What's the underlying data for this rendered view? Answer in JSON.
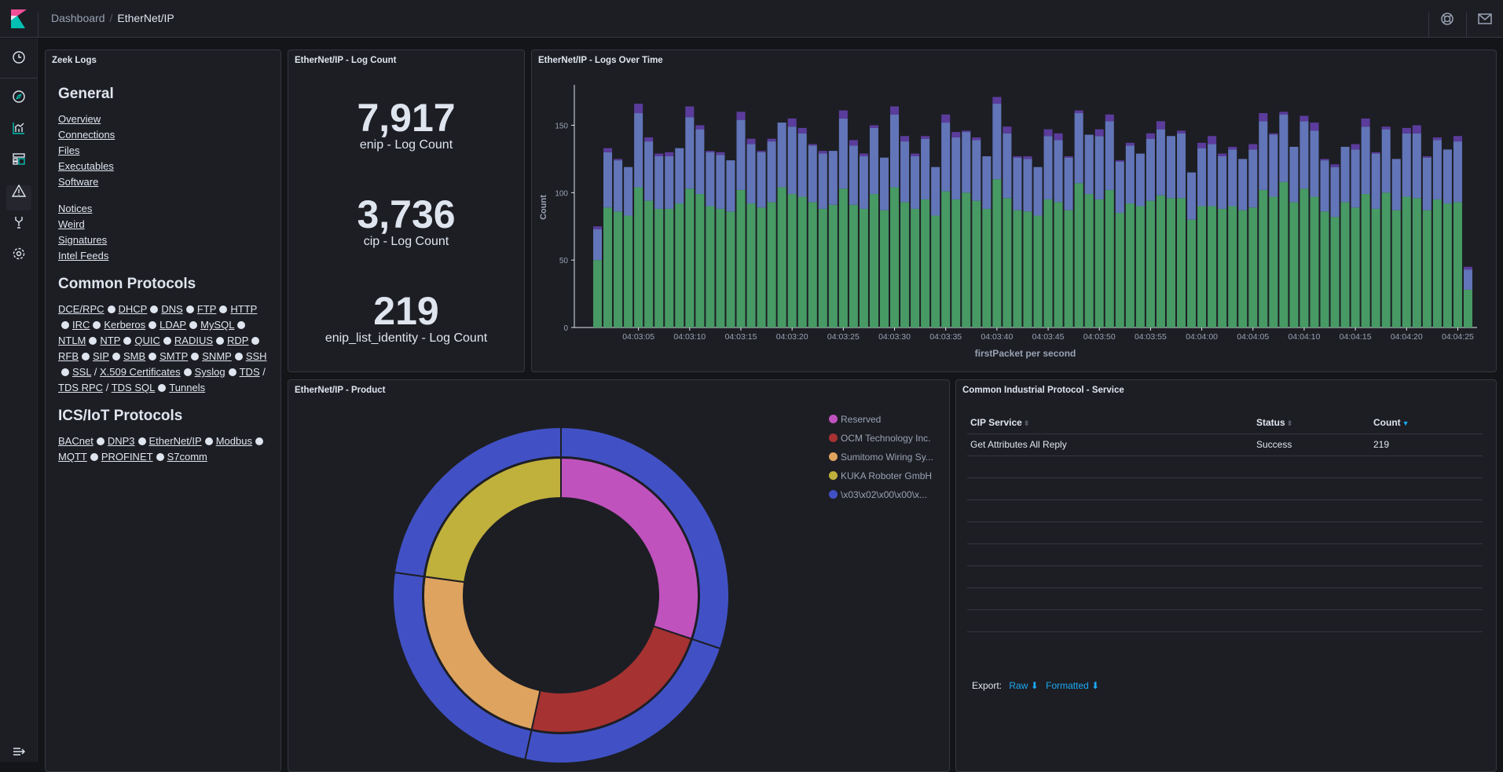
{
  "header": {
    "breadcrumb": [
      "Dashboard",
      "EtherNet/IP"
    ]
  },
  "zeek": {
    "title": "Zeek Logs",
    "general_heading": "General",
    "general_links": [
      "Overview",
      "Connections",
      "Files",
      "Executables",
      "Software"
    ],
    "general_links2": [
      "Notices",
      "Weird",
      "Signatures",
      "Intel Feeds"
    ],
    "common_heading": "Common Protocols",
    "common_links": [
      "DCE/RPC",
      "DHCP",
      "DNS",
      "FTP",
      "HTTP",
      "IRC",
      "Kerberos",
      "LDAP",
      "MySQL",
      "NTLM",
      "NTP",
      "QUIC",
      "RADIUS",
      "RDP",
      "RFB",
      "SIP",
      "SMB",
      "SMTP",
      "SNMP",
      "SSH",
      "SSL",
      "X.509 Certificates",
      "Syslog",
      "TDS",
      "TDS RPC",
      "TDS SQL",
      "Tunnels"
    ],
    "slash": "/",
    "ics_heading": "ICS/IoT Protocols",
    "ics_links": [
      "BACnet",
      "DNP3",
      "EtherNet/IP",
      "Modbus",
      "MQTT",
      "PROFINET",
      "S7comm"
    ]
  },
  "counts": {
    "title": "EtherNet/IP - Log Count",
    "metrics": [
      {
        "value": "7,917",
        "label": "enip - Log Count"
      },
      {
        "value": "3,736",
        "label": "cip - Log Count"
      },
      {
        "value": "219",
        "label": "enip_list_identity - Log Count"
      }
    ]
  },
  "chart_data": [
    {
      "title": "EtherNet/IP - Logs Over Time",
      "type": "bar",
      "stacked": true,
      "xlabel": "firstPacket per second",
      "ylabel": "Count",
      "ylim": [
        0,
        180
      ],
      "yticks": [
        0,
        50,
        100,
        150
      ],
      "xticks": [
        "04:03:05",
        "04:03:10",
        "04:03:15",
        "04:03:20",
        "04:03:25",
        "04:03:30",
        "04:03:35",
        "04:03:40",
        "04:03:45",
        "04:03:50",
        "04:03:55",
        "04:04:00",
        "04:04:05",
        "04:04:10",
        "04:04:15",
        "04:04:20",
        "04:04:25"
      ],
      "x_start": "04:03:01",
      "x_step_seconds": 1,
      "series": [
        {
          "color": "#479a64",
          "values": [
            50,
            89,
            86,
            83,
            104,
            94,
            88,
            88,
            92,
            103,
            99,
            90,
            88,
            86,
            102,
            92,
            89,
            93,
            104,
            99,
            97,
            93,
            88,
            91,
            103,
            91,
            88,
            99,
            87,
            104,
            93,
            88,
            95,
            83,
            101,
            95,
            100,
            94,
            88,
            110,
            96,
            87,
            86,
            83,
            95,
            93,
            87,
            107,
            99,
            95,
            102,
            85,
            92,
            90,
            94,
            98,
            96,
            96,
            80,
            90,
            90,
            88,
            90,
            87,
            89,
            102,
            97,
            108,
            93,
            103,
            97,
            86,
            82,
            93,
            89,
            99,
            88,
            100,
            87,
            97,
            96,
            87,
            95,
            92,
            93,
            28
          ]
        },
        {
          "color": "#6275b8",
          "values": [
            23,
            41,
            38,
            36,
            55,
            44,
            39,
            39,
            41,
            53,
            48,
            40,
            40,
            38,
            52,
            44,
            41,
            45,
            48,
            50,
            47,
            42,
            41,
            40,
            52,
            44,
            39,
            49,
            39,
            54,
            45,
            39,
            45,
            36,
            51,
            46,
            45,
            45,
            39,
            56,
            48,
            39,
            39,
            36,
            47,
            46,
            39,
            52,
            44,
            47,
            51,
            38,
            43,
            39,
            46,
            49,
            46,
            48,
            35,
            43,
            46,
            39,
            42,
            38,
            43,
            51,
            46,
            50,
            41,
            50,
            49,
            38,
            37,
            41,
            43,
            50,
            41,
            47,
            38,
            47,
            48,
            39,
            44,
            40,
            45,
            15
          ]
        },
        {
          "color": "#5b3c9c",
          "values": [
            2,
            3,
            1,
            0,
            7,
            3,
            2,
            3,
            0,
            8,
            3,
            1,
            2,
            0,
            6,
            4,
            1,
            2,
            0,
            6,
            4,
            1,
            2,
            0,
            6,
            4,
            2,
            2,
            0,
            6,
            4,
            2,
            2,
            0,
            6,
            4,
            1,
            2,
            0,
            5,
            5,
            1,
            2,
            0,
            5,
            5,
            1,
            2,
            0,
            5,
            5,
            1,
            2,
            0,
            4,
            6,
            0,
            2,
            0,
            4,
            6,
            2,
            2,
            0,
            4,
            6,
            1,
            2,
            0,
            4,
            6,
            1,
            2,
            0,
            4,
            6,
            1,
            2,
            0,
            4,
            6,
            1,
            2,
            0,
            4,
            2
          ]
        }
      ]
    },
    {
      "title": "EtherNet/IP - Product",
      "type": "pie",
      "donut": true,
      "inner": [
        {
          "label": "Reserved",
          "value": 66,
          "color": "#c052bd"
        },
        {
          "label": "OCM Technology Inc.",
          "value": 51,
          "color": "#a63232"
        },
        {
          "label": "Sumitomo Wiring Sy...",
          "value": 52,
          "color": "#dea35e"
        },
        {
          "label": "KUKA Roboter GmbH",
          "value": 50,
          "color": "#c0b03c"
        }
      ],
      "outer": [
        {
          "label": "\\x03\\x02\\x00\\x00\\x...",
          "values": [
            66,
            51,
            52,
            50
          ],
          "color": "#4151c5"
        }
      ]
    }
  ],
  "table": {
    "title": "Common Industrial Protocol - Service",
    "columns": [
      "CIP Service",
      "Status",
      "Count"
    ],
    "rows": [
      [
        "Get Attributes All Reply",
        "Success",
        "219"
      ]
    ],
    "export_label": "Export:",
    "raw": "Raw",
    "formatted": "Formatted"
  }
}
